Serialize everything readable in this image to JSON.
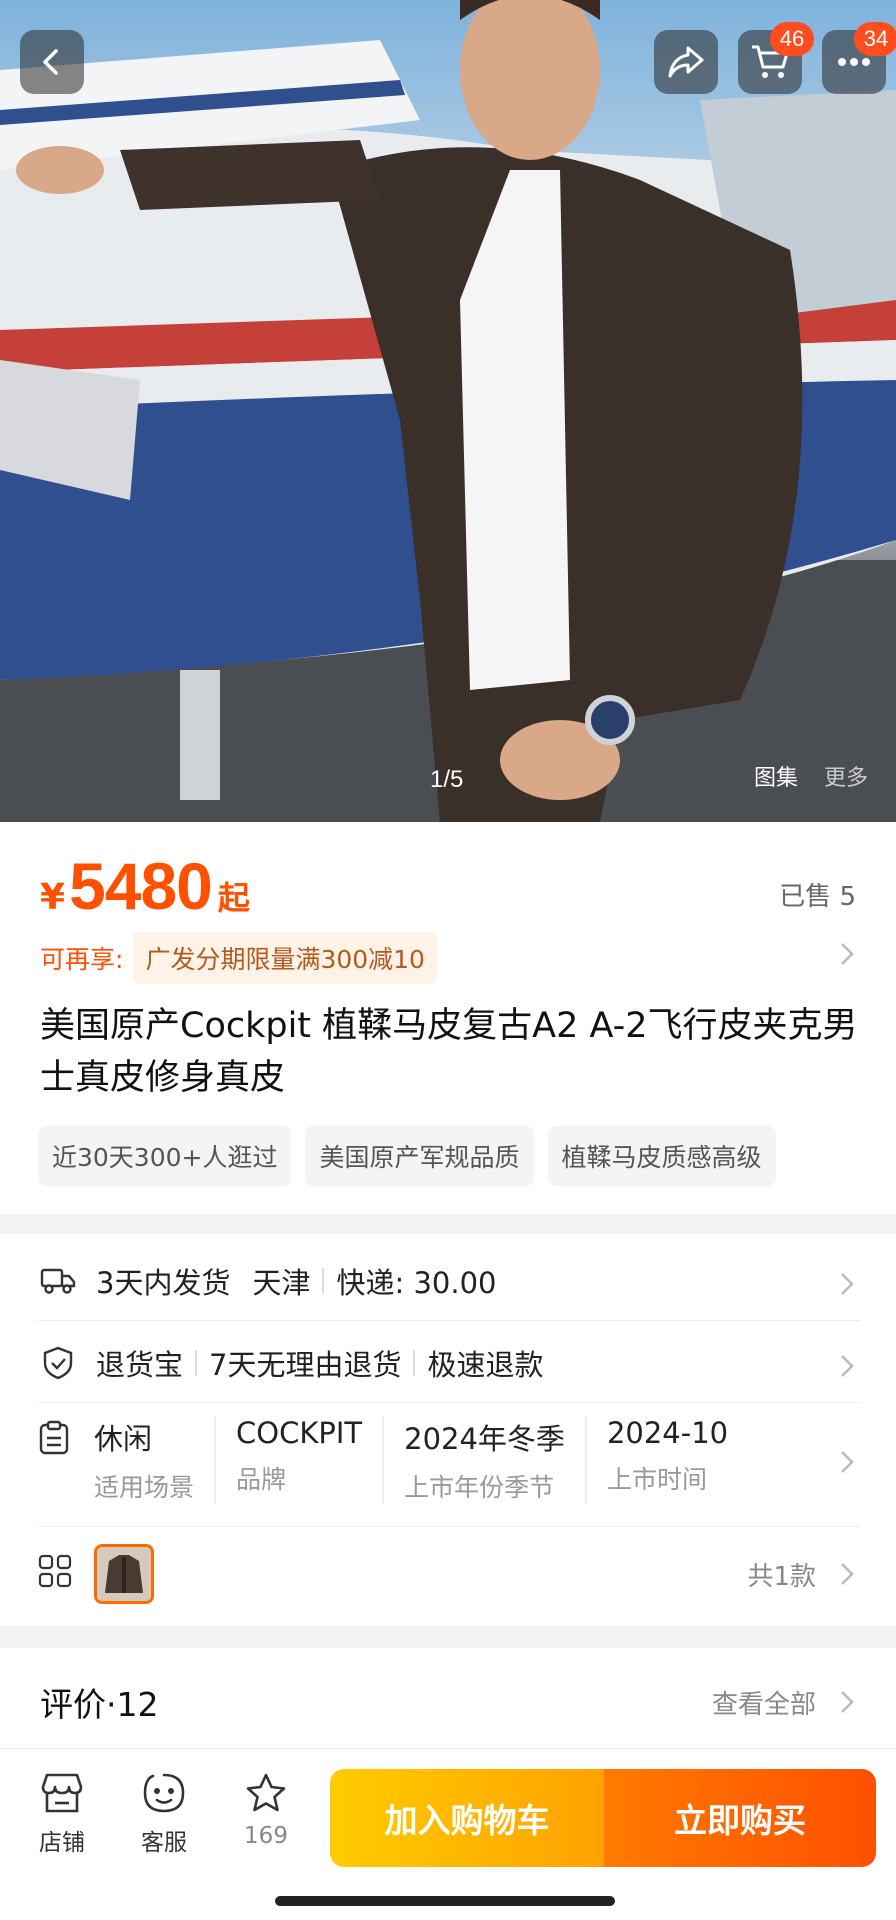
{
  "hero": {
    "counter": "1/5",
    "tabs": [
      "图集",
      "更多"
    ],
    "cart_badge": "46",
    "message_badge": "34"
  },
  "price": {
    "currency": "¥",
    "amount": "5480",
    "suffix": "起",
    "sold": "已售 5"
  },
  "promo": {
    "label": "可再享:",
    "tag": "广发分期限量满300减10"
  },
  "product": {
    "title": "美国原产Cockpit 植鞣马皮复古A2 A-2飞行皮夹克男士真皮修身真皮",
    "chips": [
      "近30天300+人逛过",
      "美国原产军规品质",
      "植鞣马皮质感高级"
    ]
  },
  "shipping": {
    "eta": "3天内发货",
    "city": "天津",
    "fee": "快递: 30.00"
  },
  "returns": {
    "brand": "退货宝",
    "policy": "7天无理由退货",
    "refund": "极速退款"
  },
  "params": [
    {
      "value": "休闲",
      "key": "适用场景"
    },
    {
      "value": "COCKPIT",
      "key": "品牌"
    },
    {
      "value": "2024年冬季",
      "key": "上市年份季节"
    },
    {
      "value": "2024-10",
      "key": "上市时间"
    }
  ],
  "styles": {
    "count": "共1款"
  },
  "reviews": {
    "title": "评价·12",
    "view_all": "查看全部"
  },
  "bottom_bar": {
    "shop": "店铺",
    "service": "客服",
    "favorites": "169",
    "add_to_cart": "加入购物车",
    "buy_now": "立即购买"
  },
  "colors": {
    "accent": "#ff5000",
    "green": "#18a957",
    "cart_gradient_start": "#ffcb00",
    "buy_gradient_end": "#ff5000"
  }
}
